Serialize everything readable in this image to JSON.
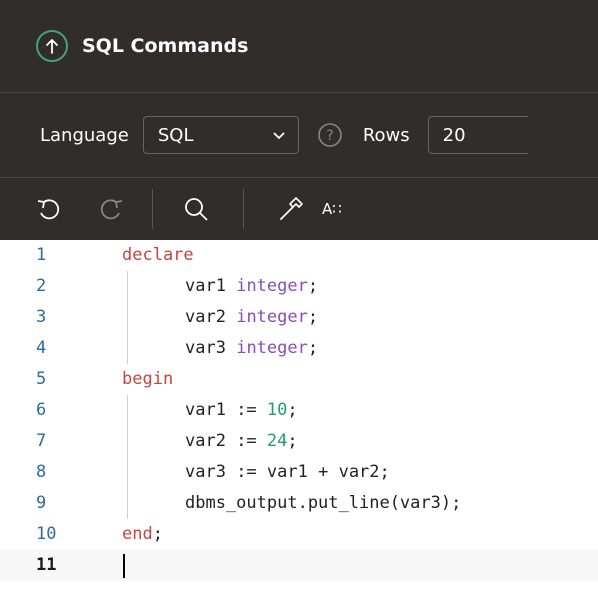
{
  "header": {
    "title": "SQL Commands",
    "icon": "up-arrow-icon"
  },
  "settings": {
    "language_label": "Language",
    "language_value": "SQL",
    "rows_label": "Rows",
    "rows_value": "20"
  },
  "toolbar": {
    "format_label": "A∷"
  },
  "editor": {
    "lines": [
      {
        "num": "1"
      },
      {
        "num": "2"
      },
      {
        "num": "3"
      },
      {
        "num": "4"
      },
      {
        "num": "5"
      },
      {
        "num": "6"
      },
      {
        "num": "7"
      },
      {
        "num": "8"
      },
      {
        "num": "9"
      },
      {
        "num": "10"
      },
      {
        "num": "11"
      }
    ],
    "tokens": {
      "declare": "declare",
      "var1": "var1",
      "var2": "var2",
      "var3": "var3",
      "integer_t": "integer",
      "semi": ";",
      "begin": "begin",
      "assign": " := ",
      "n10": "10",
      "n24": "24",
      "plus": " + ",
      "call": "dbms_output.put_line(var3);",
      "end": "end"
    }
  },
  "colors": {
    "header_bg": "#312d2a",
    "accent": "#46a17d",
    "keyword": "#c6443b",
    "type": "#8a4db0",
    "number": "#1f9e6f",
    "line_number": "#2b6c9a"
  }
}
